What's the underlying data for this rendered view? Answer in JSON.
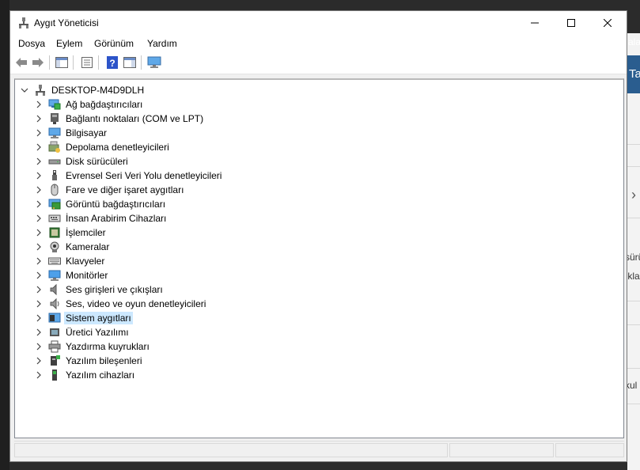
{
  "window": {
    "title": "Aygıt Yöneticisi",
    "controls": {
      "minimize": "minimize-icon",
      "maximize": "maximize-icon",
      "close": "close-icon"
    }
  },
  "menu": [
    {
      "label": "Dosya"
    },
    {
      "label": "Eylem"
    },
    {
      "label": "Görünüm"
    },
    {
      "label": "Yardım"
    }
  ],
  "toolbar": {
    "buttons": [
      "back-arrow-icon",
      "forward-arrow-icon",
      "console-tree-icon",
      "properties-icon",
      "help-icon",
      "action-pane-icon",
      "computer-monitor-icon"
    ]
  },
  "tree": {
    "root": "DESKTOP-M4D9DLH",
    "items": [
      {
        "label": "Ağ bağdaştırıcıları",
        "icon": "network-adapter-icon"
      },
      {
        "label": "Bağlantı noktaları (COM ve LPT)",
        "icon": "port-icon"
      },
      {
        "label": "Bilgisayar",
        "icon": "computer-icon"
      },
      {
        "label": "Depolama denetleyicileri",
        "icon": "storage-controller-icon"
      },
      {
        "label": "Disk sürücüleri",
        "icon": "disk-drive-icon"
      },
      {
        "label": "Evrensel Seri Veri Yolu denetleyicileri",
        "icon": "usb-icon"
      },
      {
        "label": "Fare ve diğer işaret aygıtları",
        "icon": "mouse-icon"
      },
      {
        "label": "Görüntü bağdaştırıcıları",
        "icon": "display-adapter-icon"
      },
      {
        "label": "İnsan Arabirim Cihazları",
        "icon": "hid-icon"
      },
      {
        "label": "İşlemciler",
        "icon": "processor-icon"
      },
      {
        "label": "Kameralar",
        "icon": "camera-icon"
      },
      {
        "label": "Klavyeler",
        "icon": "keyboard-icon"
      },
      {
        "label": "Monitörler",
        "icon": "monitor-icon"
      },
      {
        "label": "Ses girişleri ve çıkışları",
        "icon": "speaker-icon"
      },
      {
        "label": "Ses, video ve oyun denetleyicileri",
        "icon": "sound-icon"
      },
      {
        "label": "Sistem aygıtları",
        "icon": "system-devices-icon",
        "selected": true
      },
      {
        "label": "Üretici Yazılımı",
        "icon": "firmware-icon"
      },
      {
        "label": "Yazdırma kuyrukları",
        "icon": "printer-icon"
      },
      {
        "label": "Yazılım bileşenleri",
        "icon": "software-component-icon"
      },
      {
        "label": "Yazılım cihazları",
        "icon": "software-device-icon"
      }
    ]
  },
  "background": {
    "texts": [
      "ala",
      "Ta",
      "sürü",
      "ıkla",
      "kul"
    ]
  }
}
